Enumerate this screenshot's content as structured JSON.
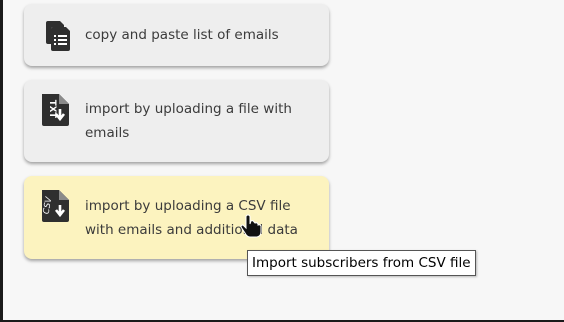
{
  "options": [
    {
      "label": "copy and paste list of emails",
      "icon": "paste-list-icon",
      "selected": false
    },
    {
      "label": "import by uploading a file with emails",
      "icon": "txt-file-upload-icon",
      "selected": false
    },
    {
      "label": "import by uploading a CSV file with emails and additional data",
      "icon": "csv-file-upload-icon",
      "selected": true
    }
  ],
  "tooltip": {
    "text": "Import subscribers from CSV file"
  },
  "colors": {
    "card": "#eeeeee",
    "card_selected": "#fcf3bf",
    "icon": "#2f2f2f"
  }
}
